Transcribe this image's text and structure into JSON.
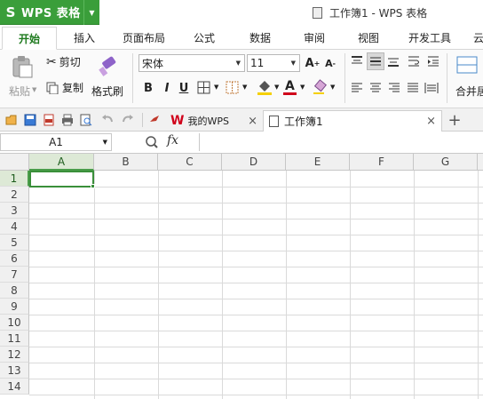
{
  "app": {
    "logo": "S",
    "name": "WPS 表格"
  },
  "window": {
    "title": "工作簿1 - WPS 表格"
  },
  "menu": {
    "tabs": [
      "开始",
      "插入",
      "页面布局",
      "公式",
      "数据",
      "审阅",
      "视图",
      "开发工具",
      "云"
    ],
    "active_index": 0
  },
  "ribbon": {
    "paste_label": "粘贴",
    "cut_label": "剪切",
    "copy_label": "复制",
    "format_painter_label": "格式刷",
    "font_name": "宋体",
    "font_size": "11",
    "bold": "B",
    "italic": "I",
    "underline": "U",
    "merge_label": "合并居",
    "font_color": "#d0021b",
    "highlight_color": "#f5d000",
    "font_color_glyph": "A",
    "grow_glyph": "A",
    "shrink_glyph": "A",
    "grow_sign": "+",
    "shrink_sign": "-"
  },
  "doc_tabs": [
    {
      "label": "我的WPS",
      "close": "×"
    },
    {
      "label": "工作簿1",
      "close": "×"
    }
  ],
  "new_tab_glyph": "+",
  "formula_bar": {
    "cell_ref": "A1",
    "fx": "fx",
    "value": ""
  },
  "sheet": {
    "columns": [
      "A",
      "B",
      "C",
      "D",
      "E",
      "F",
      "G"
    ],
    "rows": [
      "1",
      "2",
      "3",
      "4",
      "5",
      "6",
      "7",
      "8",
      "9",
      "10",
      "11",
      "12",
      "13",
      "14"
    ],
    "selected_cell": "A1",
    "accent": "#3a8f3a"
  }
}
